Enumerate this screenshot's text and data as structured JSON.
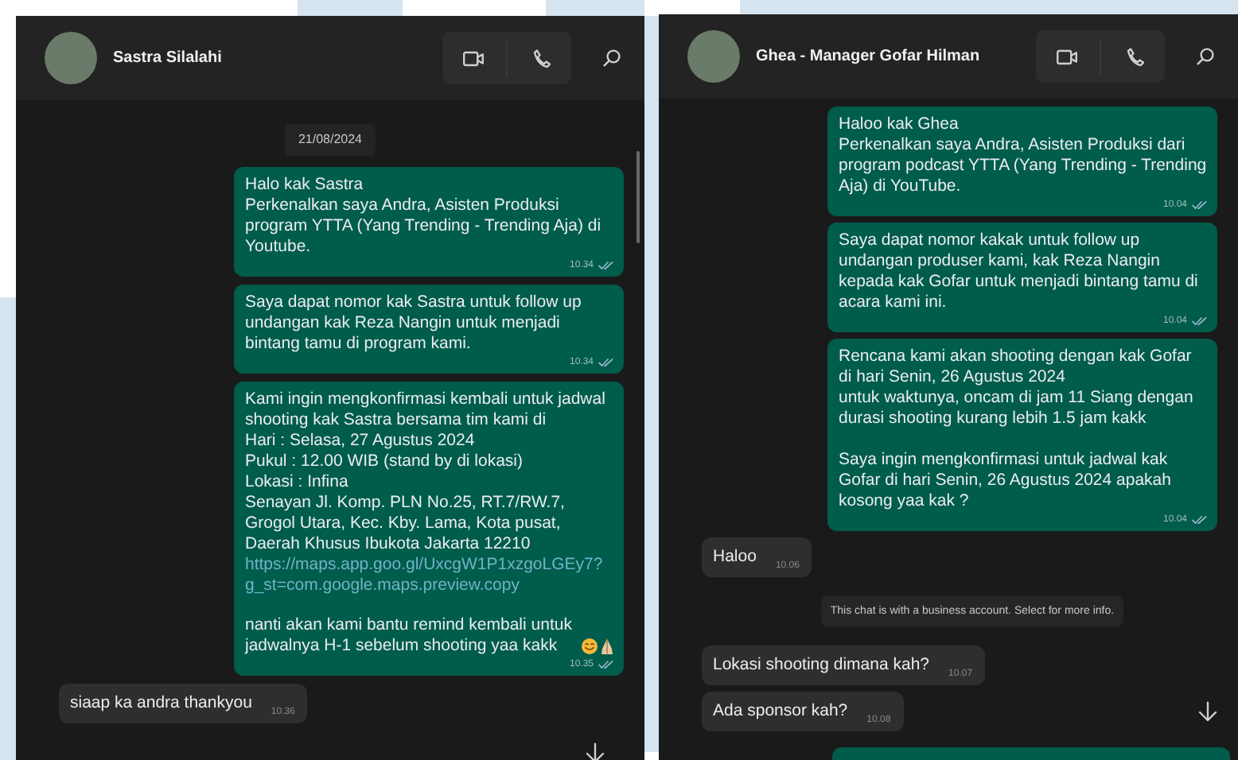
{
  "chats": [
    {
      "contact": "Sastra Silalahi",
      "date_chip": "21/08/2024",
      "messages": [
        {
          "kind": "out",
          "time": "10.34",
          "parts": [
            {
              "kind": "text",
              "text": "Halo kak Sastra\nPerkenalkan saya Andra, Asisten Produksi program YTTA (Yang Trending - Trending Aja) di Youtube."
            }
          ]
        },
        {
          "kind": "out",
          "time": "10.34",
          "parts": [
            {
              "kind": "text",
              "text": "Saya dapat nomor kak Sastra untuk follow up undangan kak Reza Nangin untuk menjadi bintang tamu di program kami."
            }
          ]
        },
        {
          "kind": "out",
          "time": "10.35",
          "parts": [
            {
              "kind": "text",
              "text": "Kami ingin mengkonfirmasi kembali untuk jadwal shooting kak Sastra bersama tim kami di\nHari : Selasa, 27 Agustus 2024\nPukul : 12.00 WIB (stand by di lokasi)\nLokasi : Infina\nSenayan Jl. Komp. PLN No.25, RT.7/RW.7, Grogol Utara, Kec. Kby. Lama, Kota pusat, Daerah Khusus Ibukota Jakarta 12210"
            },
            {
              "kind": "link",
              "text": "https://maps.app.goo.gl/UxcgW1P1xzgoLGEy7?g_st=com.google.maps.preview.copy"
            },
            {
              "kind": "text",
              "text": "nanti akan kami bantu remind kembali untuk jadwalnya H-1 sebelum shooting yaa kakk"
            },
            {
              "kind": "smile"
            },
            {
              "kind": "pray"
            }
          ]
        },
        {
          "kind": "in",
          "time": "10.36",
          "parts": [
            {
              "kind": "text",
              "text": "siaap ka andra thankyou"
            }
          ]
        }
      ]
    },
    {
      "contact": "Ghea - Manager Gofar Hilman",
      "messages": [
        {
          "kind": "out",
          "time": "10.04",
          "parts": [
            {
              "kind": "text",
              "text": "Haloo kak Ghea\nPerkenalkan saya Andra, Asisten Produksi dari program podcast YTTA (Yang Trending - Trending Aja) di YouTube."
            }
          ]
        },
        {
          "kind": "out",
          "time": "10.04",
          "parts": [
            {
              "kind": "text",
              "text": "Saya dapat nomor kakak untuk follow up undangan produser kami, kak Reza Nangin kepada kak Gofar untuk menjadi bintang tamu di acara kami ini."
            }
          ]
        },
        {
          "kind": "out",
          "time": "10.04",
          "parts": [
            {
              "kind": "text",
              "text": "Rencana kami akan shooting dengan kak Gofar di hari Senin, 26 Agustus 2024\nuntuk waktunya, oncam di jam 11 Siang dengan durasi shooting kurang lebih 1.5 jam kakk\n\nSaya ingin mengkonfirmasi untuk jadwal kak Gofar di hari Senin, 26 Agustus 2024 apakah kosong yaa kak ?"
            }
          ]
        },
        {
          "kind": "in",
          "time": "10.06",
          "parts": [
            {
              "kind": "text",
              "text": "Haloo"
            }
          ]
        },
        {
          "kind": "system",
          "parts": [
            {
              "kind": "text",
              "text": "This chat is with a business account. Select for more info."
            }
          ]
        },
        {
          "kind": "in",
          "time": "10.07",
          "parts": [
            {
              "kind": "text",
              "text": "Lokasi shooting dimana kah?"
            }
          ]
        },
        {
          "kind": "in",
          "time": "10.08",
          "parts": [
            {
              "kind": "text",
              "text": "Ada sponsor kah?"
            }
          ]
        },
        {
          "kind": "out_partial"
        }
      ]
    }
  ]
}
